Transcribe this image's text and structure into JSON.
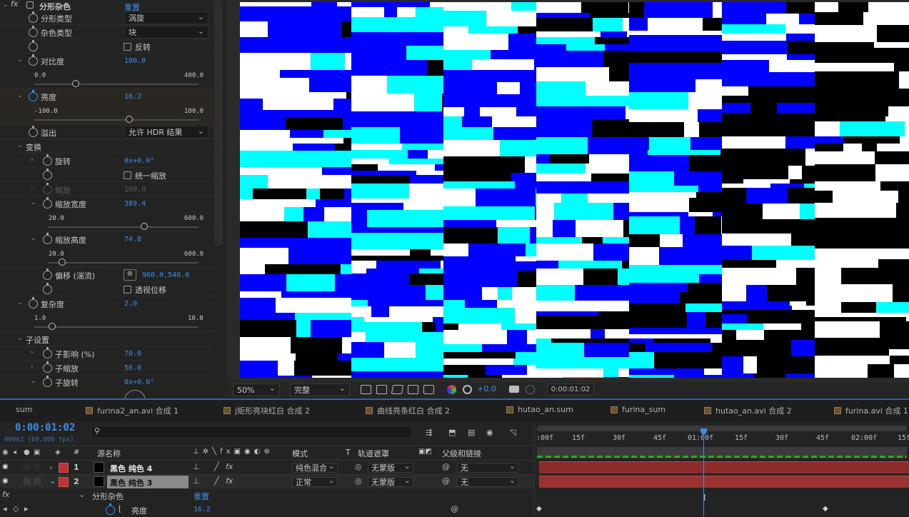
{
  "effect": {
    "name": "分形杂色",
    "reset": "重置"
  },
  "props": {
    "fractal_type": {
      "label": "分形类型",
      "value": "涡旋"
    },
    "noise_type": {
      "label": "杂色类型",
      "value": "块"
    },
    "invert": {
      "label": "反转"
    },
    "contrast": {
      "label": "对比度",
      "value": "100.0",
      "min": "0.0",
      "max": "400.0",
      "pos": 0.25
    },
    "brightness": {
      "label": "亮度",
      "value": "16.2",
      "min": "-100.0",
      "max": "100.0",
      "pos": 0.58
    },
    "overflow": {
      "label": "溢出",
      "value": "允许 HDR 结果"
    },
    "transform": {
      "label": "变换"
    },
    "rotation": {
      "label": "旋转",
      "value": "0x+0.0°"
    },
    "uniform_scale": {
      "label": "统一缩放"
    },
    "scale": {
      "label": "缩放",
      "value": "100.0"
    },
    "scale_width": {
      "label": "缩放宽度",
      "value": "389.4",
      "min": "20.0",
      "max": "600.0",
      "pos": 0.64
    },
    "scale_height": {
      "label": "缩放高度",
      "value": "74.8",
      "min": "20.0",
      "max": "600.0",
      "pos": 0.09
    },
    "offset": {
      "label": "偏移 (湍流)",
      "value": "960.0,540.0"
    },
    "perspective": {
      "label": "透视位移"
    },
    "complexity": {
      "label": "复杂度",
      "value": "2.0",
      "min": "1.0",
      "max": "10.0",
      "pos": 0.11
    },
    "sub_settings": {
      "label": "子设置"
    },
    "sub_influence": {
      "label": "子影响 (%)",
      "value": "70.0"
    },
    "sub_scale": {
      "label": "子缩放",
      "value": "56.0"
    },
    "sub_rotation": {
      "label": "子旋转",
      "value": "0x+0.0°"
    }
  },
  "viewer": {
    "zoom": "50%",
    "quality": "完整",
    "exposure": "+0.0",
    "timecode": "0:00:01:02"
  },
  "tabs": [
    "sum",
    "furina2_an.avi 合成 1",
    "j矩形亮块红白 合成 2",
    "曲线亮条红白 合成 2",
    "hutao_an.sum",
    "furina_sum",
    "hutao_an.avi 合成 2",
    "furina.avi 合成 1"
  ],
  "timeline": {
    "time": "0:00:01:02",
    "frames": "00062 (60.000 fps)",
    "headers": {
      "name": "源名称",
      "mode": "模式",
      "t": "T",
      "matte": "轨道遮罩",
      "parent": "父级和链接",
      "num": "#"
    },
    "layers": [
      {
        "num": "1",
        "name": "黑色 纯色 4",
        "mode": "纯色混合",
        "matte": "无蒙版",
        "parent": "无"
      },
      {
        "num": "2",
        "name": "黑色 纯色 3",
        "mode": "正常",
        "matte": "无蒙版",
        "parent": "无"
      }
    ],
    "effect_row": {
      "name": "分形杂色",
      "reset": "重置"
    },
    "prop_row": {
      "name": "亮度",
      "value": "16.2"
    },
    "ruler": [
      ":00f",
      "15f",
      "30f",
      "45f",
      "01:00f",
      "15f",
      "30f",
      "45f",
      "02:00f",
      "15f"
    ],
    "playhead": 0.45
  },
  "colors": {
    "accent": "#2f8ff5",
    "layer_bar": "#8c2b2b",
    "cyan": "#00ffff",
    "blue": "#0000ff"
  }
}
